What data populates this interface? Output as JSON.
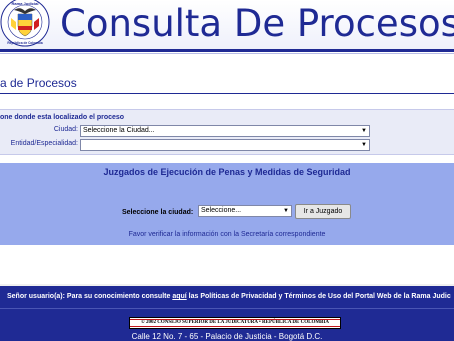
{
  "header": {
    "title": "Consulta De Procesos",
    "logo_icon": "rama-judicial-seal-icon",
    "logo_text_top": "Rama Judicial",
    "logo_text_bottom": "República de Colombia"
  },
  "page": {
    "title": "a de Procesos"
  },
  "form": {
    "instruction": "one donde esta localizado el proceso",
    "ciudad_label": "Ciudad:",
    "ciudad_value": "Seleccione la Ciudad...",
    "entidad_label": "Entidad/Especialidad:",
    "entidad_value": ""
  },
  "juzgados": {
    "title": "Juzgados de Ejecución de Penas y Medidas de Seguridad",
    "city_label": "Seleccione la ciudad:",
    "city_value": "Seleccione...",
    "button_label": "Ir a Juzgado",
    "note": "Favor verificar la información con la Secretaría correspondiente"
  },
  "footer": {
    "notice_prefix": "Señor usuario(a): Para su conocimiento consulte ",
    "notice_link": "aquí",
    "notice_suffix": " las Políticas de Privacidad y Términos de Uso del Portal Web de la Rama Judic",
    "copyright": "© 2002 CONSEJO SUPERIOR DE LA JUDICATURA • REPÚBLICA DE COLOMBIA",
    "address": "Calle 12 No. 7 - 65 - Palacio de Justicia - Bogotá D.C."
  },
  "colors": {
    "brand_blue": "#1f2a94",
    "panel_blue": "#96a9ec",
    "form_bg": "#e9ebf7",
    "badge_red": "#c0141a"
  }
}
